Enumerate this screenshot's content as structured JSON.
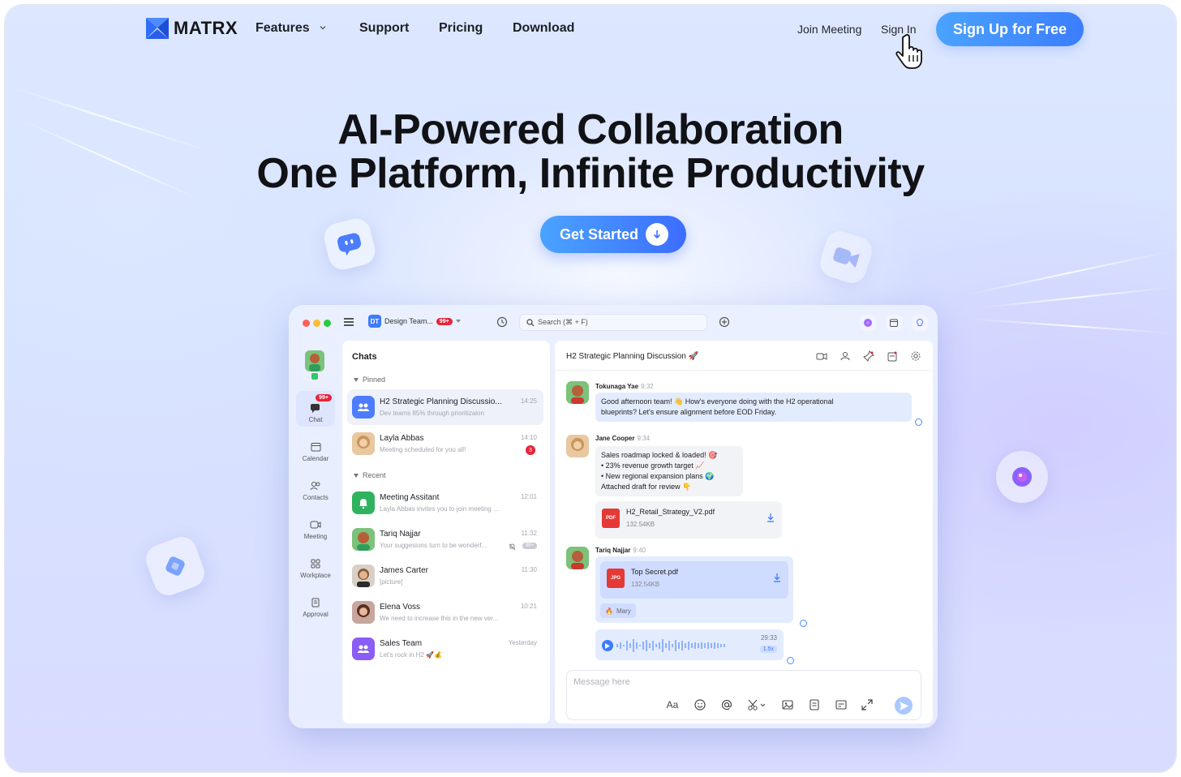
{
  "nav": {
    "brand": "MATRX",
    "links": [
      "Features",
      "Support",
      "Pricing",
      "Download"
    ],
    "join_meeting": "Join Meeting",
    "sign_in": "Sign In",
    "sign_up": "Sign Up for Free"
  },
  "hero": {
    "title_line1": "AI-Powered Collaboration",
    "title_line2": "One Platform, Infinite Productivity",
    "cta": "Get Started"
  },
  "app": {
    "team_label": "Design Team...",
    "team_initials": "DT",
    "team_badge": "99+",
    "search_placeholder": "Search (⌘ + F)",
    "rail": {
      "chat_badge": "99+",
      "items": [
        "Chat",
        "Calendar",
        "Contacts",
        "Meeting",
        "Workplace",
        "Approval"
      ]
    },
    "chats": {
      "title": "Chats",
      "pinned_label": "Pinned",
      "recent_label": "Recent",
      "pinned": [
        {
          "name": "H2 Strategic Planning Discussio...",
          "preview": "Dev teams 85% through prioritizaion",
          "time": "14:25"
        },
        {
          "name": "Layla Abbas",
          "preview": "Meeting scheduled for you all!",
          "time": "14:10",
          "unread": "3"
        }
      ],
      "recent": [
        {
          "name": "Meeting Assitant",
          "preview": "Layla Abbas invites you to join meeting ...",
          "time": "12:01"
        },
        {
          "name": "Tariq Najjar",
          "preview": "Your suggesions turn to be wonderf...",
          "time": "11:32",
          "badge": "99+"
        },
        {
          "name": "James Carter",
          "preview": "[picture]",
          "time": "11:30"
        },
        {
          "name": "Elena Voss",
          "preview": "We need to increase this in the new ver...",
          "time": "10:21"
        },
        {
          "name": "Sales Team",
          "preview": "Let's rock in H2 🚀💰",
          "time": "Yesterday"
        }
      ]
    },
    "conversation": {
      "title": "H2 Strategic Planning Discussion 🚀",
      "messages": {
        "m1_name": "Tokunaga Yae",
        "m1_time": "9:32",
        "m1_line1": "Good afternoon team! 👋 How's everyone doing with the H2 operational",
        "m1_line2": "blueprints? Let's ensure alignment before EOD Friday.",
        "m2_name": "Jane Cooper",
        "m2_time": "9:34",
        "m2_line1": "Sales roadmap locked & loaded! 🎯",
        "m2_line2": "• 23% revenue growth target 📈",
        "m2_line3": "• New regional expansion plans 🌍",
        "m2_line4": "Attached draft for review 👇",
        "m2_file_name": "H2_Retail_Strategy_V2.pdf",
        "m2_file_size": "132.54KB",
        "m2_file_type": "PDF",
        "m3_name": "Tariq Najjar",
        "m3_time": "9:40",
        "m3_file_name": "Top Secret.pdf",
        "m3_file_size": "132.54KB",
        "m3_file_type": "JPG",
        "m3_reaction": "Mary",
        "voice_duration": "29:33",
        "voice_speed": "1.5x"
      },
      "input_placeholder": "Message here",
      "font_tool": "Aa"
    }
  },
  "colors": {
    "accent": "#3b7dff",
    "accent_light": "#4aa3ff",
    "badge": "#e8233b"
  }
}
